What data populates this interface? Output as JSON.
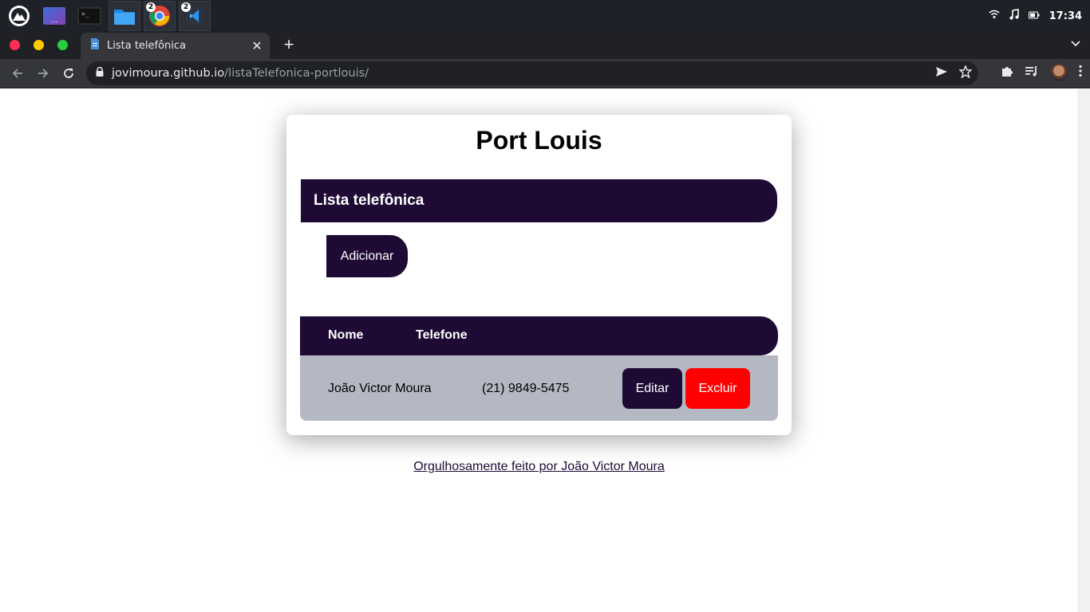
{
  "os": {
    "tray": {
      "wifi_icon": "wifi-icon",
      "music_icon": "music-icon",
      "battery_icon": "battery-icon",
      "clock": "17:34"
    },
    "apps": [
      {
        "name": "launcher",
        "badge": ""
      },
      {
        "name": "desktop",
        "badge": ""
      },
      {
        "name": "terminal",
        "badge": ""
      },
      {
        "name": "files",
        "badge": ""
      },
      {
        "name": "chrome",
        "badge": "2"
      },
      {
        "name": "vscode",
        "badge": "2"
      }
    ]
  },
  "browser": {
    "tab": {
      "title": "Lista telefônica"
    },
    "address": {
      "host": "jovimoura.github.io",
      "path": "/listaTelefonica-portlouis/"
    }
  },
  "page": {
    "title": "Port Louis",
    "section_header": "Lista telefônica",
    "add_button": "Adicionar",
    "table": {
      "headers": {
        "name": "Nome",
        "phone": "Telefone"
      },
      "rows": [
        {
          "name": "João Victor Moura",
          "phone": "(21) 9849-5475",
          "edit": "Editar",
          "delete": "Excluir"
        }
      ]
    },
    "footer": {
      "prefix": "Orgulhosamente feito por ",
      "author": "João Victor Moura"
    }
  },
  "colors": {
    "primary": "#1e0a34",
    "danger": "#ff0000",
    "row_bg": "#b4b8c3"
  }
}
